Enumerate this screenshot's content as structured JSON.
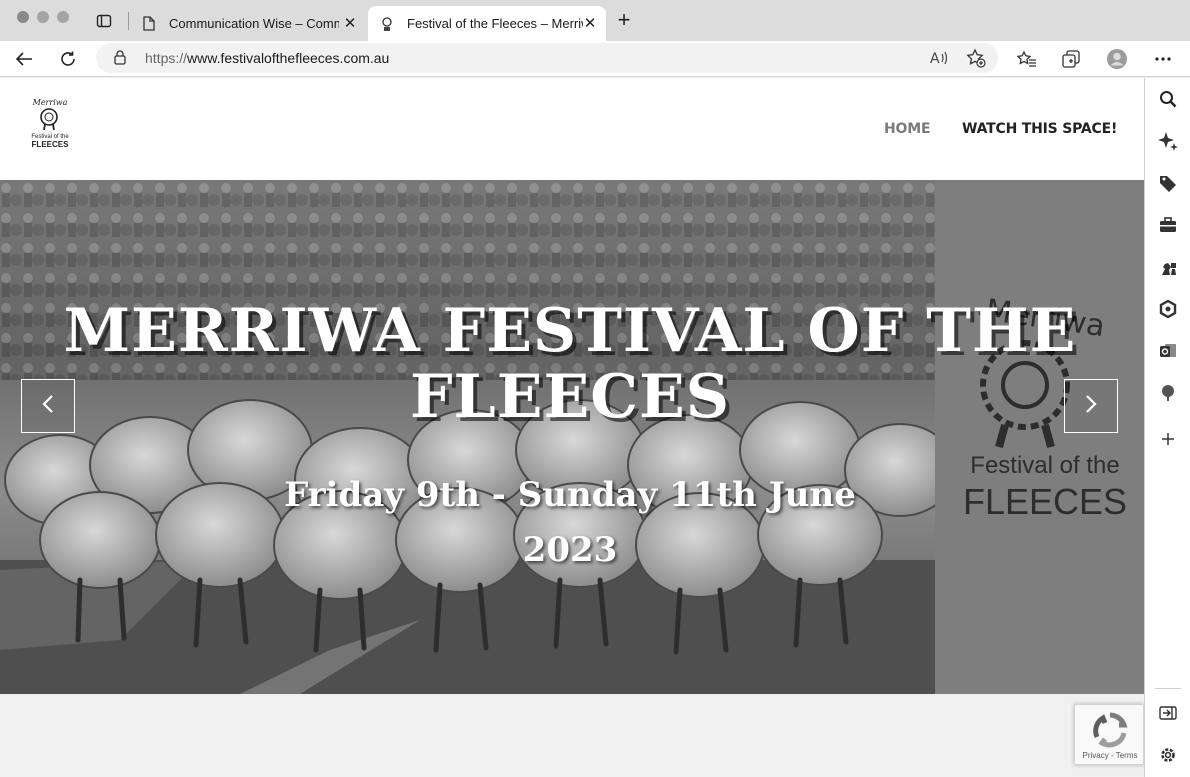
{
  "browser": {
    "tabs": [
      {
        "title": "Communication Wise – Comm",
        "active": false,
        "favicon": "document-icon"
      },
      {
        "title": "Festival of the Fleeces – Merriw",
        "active": true,
        "favicon": "sheep-favicon"
      }
    ],
    "url_scheme": "https://",
    "url_host": "www.festivalofthefleeces.com.au"
  },
  "site": {
    "logo_top": "Merriwa",
    "logo_mid": "Festival of the",
    "logo_bottom": "FLEECES",
    "nav": [
      {
        "label": "HOME",
        "active": true
      },
      {
        "label": "WATCH THIS SPACE!",
        "active": false
      }
    ]
  },
  "hero": {
    "title": "MERRIWA FESTIVAL OF THE FLEECES",
    "subtitle": "Friday 9th - Sunday 11th June 2023",
    "side_logo_top": "Merriwa",
    "side_logo_mid": "Festival of the",
    "side_logo_bottom": "FLEECES"
  },
  "recaptcha": {
    "text": "Privacy - Terms"
  }
}
